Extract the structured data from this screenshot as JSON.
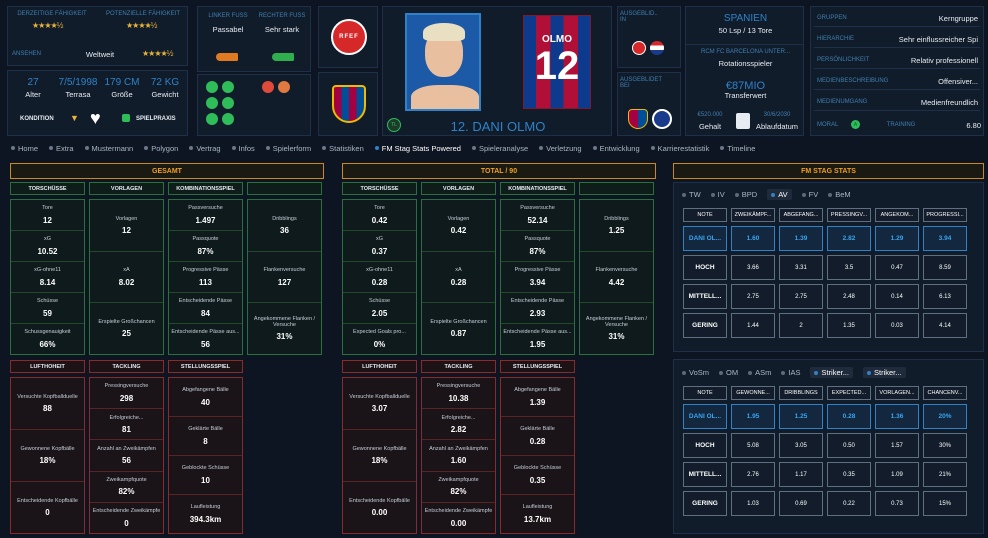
{
  "header": {
    "ratings": {
      "current_label": "Derzeitige Fähigkeit",
      "current_stars": "★★★★½",
      "potential_label": "Potenzielle Fähigkeit",
      "potential_stars": "★★★★½",
      "reputation_label": "Ansehen",
      "reputation_value": "Weltweit",
      "reputation_stars": "★★★★½"
    },
    "bio": {
      "age": "27",
      "age_label": "Alter",
      "dob": "7/5/1998",
      "dob_label": "Terrasa",
      "height": "179 CM",
      "height_label": "Größe",
      "weight": "72 KG",
      "weight_label": "Gewicht",
      "condition_label": "Kondition",
      "practice_label": "Spielpraxis"
    },
    "feet": {
      "left_label": "Linker Fuß",
      "left_value": "Passabel",
      "right_label": "Rechter Fuß",
      "right_value": "Sehr stark"
    },
    "player": {
      "number": "12",
      "shirt_name": "OLMO",
      "title": "12. DANI OLMO",
      "badge": "TL"
    },
    "nation": {
      "label": "Ausgeblid.. in",
      "country": "SPANIEN",
      "caps": "50 Lsp / 13 Tore"
    },
    "club": {
      "label": "Ausgeblidet bei",
      "name": "RCM FC BARCELONA UNTER...",
      "role": "Rotationsspieler",
      "value": "€87MIO",
      "value_label": "Transferwert",
      "wage": "€520.000",
      "wage_label": "Gehalt",
      "expiry": "30/6/2030",
      "expiry_label": "Ablaufdatum"
    },
    "personality": [
      {
        "label": "Gruppen",
        "value": "Kerngruppe"
      },
      {
        "label": "Hierarchie",
        "value": "Sehr einflussreicher Spi"
      },
      {
        "label": "Persönlichkeit",
        "value": "Relativ professionell"
      },
      {
        "label": "Medienbeschreibung",
        "value": "Offensiver..."
      },
      {
        "label": "Medienumgang",
        "value": "Medienfreundlich"
      }
    ],
    "morale": {
      "label": "Moral",
      "training_label": "Training",
      "training_value": "6.80",
      "morale_badge": "A"
    }
  },
  "tabs": [
    "Home",
    "Extra",
    "Mustermann",
    "Polygon",
    "Vertrag",
    "Infos",
    "Spielerform",
    "Statistiken",
    "FM Stag Stats Powered",
    "Spieleranalyse",
    "Verletzung",
    "Entwicklung",
    "Karrierestatistik",
    "Timeline"
  ],
  "gesamt": {
    "title": "GESAMT",
    "heads": {
      "shots": "TORSCHÜSSE",
      "assists": "VORLAGEN",
      "combo": "KOMBINATIONSSPIEL",
      "air": "LUFTHOHEIT",
      "tackle": "TACKLING",
      "pos": "STELLUNGSSPIEL"
    },
    "shots": [
      [
        "Tore",
        "12"
      ],
      [
        "xG",
        "10.52"
      ],
      [
        "xG-ohne11",
        "8.14"
      ],
      [
        "Schüsse",
        "59"
      ],
      [
        "Schussgenauigkeit",
        "66%"
      ]
    ],
    "assists": [
      [
        "Vorlagen",
        "12"
      ],
      [
        "xA",
        "8.02"
      ],
      [
        "Erspielte Großchancen",
        "25"
      ]
    ],
    "combo": [
      [
        "Passversuche",
        "1.497"
      ],
      [
        "Passquote",
        "87%"
      ],
      [
        "Progressive Pässe",
        "113"
      ],
      [
        "Entscheidende Pässe",
        "84"
      ],
      [
        "Entscheidende Pässe aus...",
        "56"
      ]
    ],
    "combo2": [
      [
        "Dribblings",
        "36"
      ],
      [
        "Flankenversuche",
        "127"
      ],
      [
        "Angekommene Flanken / Versuche",
        "31%"
      ]
    ],
    "air": [
      [
        "Versuchte Kopfballduelle",
        "88"
      ],
      [
        "Gewonnene Kopfbälle",
        "18%"
      ],
      [
        "Entscheidende Kopfbälle",
        "0"
      ]
    ],
    "tackle": [
      [
        "Pressingversuche",
        "298"
      ],
      [
        "Erfolgreiche...",
        "81"
      ],
      [
        "Anzahl an Zweikämpfen",
        "56"
      ],
      [
        "Zweikampfquote",
        "82%"
      ],
      [
        "Entscheidende Zweikämpfe",
        "0"
      ]
    ],
    "pos": [
      [
        "Abgefangene Bälle",
        "40"
      ],
      [
        "Geklärte Bälle",
        "8"
      ],
      [
        "Geblockte Schüsse",
        "10"
      ],
      [
        "Laufleistung",
        "394.3km"
      ]
    ]
  },
  "per90": {
    "title": "TOTAL / 90",
    "shots": [
      [
        "Tore",
        "0.42"
      ],
      [
        "xG",
        "0.37"
      ],
      [
        "xG-ohne11",
        "0.28"
      ],
      [
        "Schüsse",
        "2.05"
      ],
      [
        "Expected Goals pro...",
        "0%"
      ]
    ],
    "assists": [
      [
        "Vorlagen",
        "0.42"
      ],
      [
        "xA",
        "0.28"
      ],
      [
        "Erspielte Großchancen",
        "0.87"
      ]
    ],
    "combo": [
      [
        "Passversuche",
        "52.14"
      ],
      [
        "Passquote",
        "87%"
      ],
      [
        "Progressive Pässe",
        "3.94"
      ],
      [
        "Entscheidende Pässe",
        "2.93"
      ],
      [
        "Entscheidende Pässe aus...",
        "1.95"
      ]
    ],
    "combo2": [
      [
        "Dribblings",
        "1.25"
      ],
      [
        "Flankenversuche",
        "4.42"
      ],
      [
        "Angekommene Flanken / Versuche",
        "31%"
      ]
    ],
    "air": [
      [
        "Versuchte Kopfballduelle",
        "3.07"
      ],
      [
        "Gewonnene Kopfbälle",
        "18%"
      ],
      [
        "Entscheidende Kopfbälle",
        "0.00"
      ]
    ],
    "tackle": [
      [
        "Pressingversuche",
        "10.38"
      ],
      [
        "Erfolgreiche...",
        "2.82"
      ],
      [
        "Anzahl an Zweikämpfen",
        "1.60"
      ],
      [
        "Zweikampfquote",
        "82%"
      ],
      [
        "Entscheidende Zweikämpfe",
        "0.00"
      ]
    ],
    "pos": [
      [
        "Abgefangene Bälle",
        "1.39"
      ],
      [
        "Geklärte Bälle",
        "0.28"
      ],
      [
        "Geblockte Schüsse",
        "0.35"
      ],
      [
        "Laufleistung",
        "13.7km"
      ]
    ]
  },
  "stag": {
    "title": "FM STAG STATS",
    "tabs1": [
      "TW",
      "IV",
      "BPD",
      "AV",
      "FV",
      "BeM"
    ],
    "tabs1_active": "AV",
    "t1_head": [
      "NOTE",
      "ZWEIKÄMPF...",
      "ABGEFANG...",
      "PRESSINGV...",
      "ANGEKOM...",
      "PROGRESSI..."
    ],
    "t1_rows": [
      [
        "DANI OL...",
        "1.60",
        "1.39",
        "2.82",
        "1.29",
        "3.94"
      ],
      [
        "HOCH",
        "3.66",
        "3.31",
        "3.5",
        "0.47",
        "8.59"
      ],
      [
        "MITTELL...",
        "2.75",
        "2.75",
        "2.48",
        "0.14",
        "6.13"
      ],
      [
        "GERING",
        "1.44",
        "2",
        "1.35",
        "0.03",
        "4.14"
      ]
    ],
    "tabs2": [
      "VoSm",
      "OM",
      "ASm",
      "IAS",
      "Striker...",
      "Striker..."
    ],
    "tabs2_active": "Striker...",
    "t2_head": [
      "NOTE",
      "GEWONNE...",
      "DRIBBLINGS",
      "EXPECTED...",
      "VORLAGEN...",
      "CHANCENV..."
    ],
    "t2_rows": [
      [
        "DANI OL...",
        "1.95",
        "1.25",
        "0.28",
        "1.36",
        "20%"
      ],
      [
        "HOCH",
        "5.08",
        "3.05",
        "0.50",
        "1.57",
        "30%"
      ],
      [
        "MITTELL...",
        "2.76",
        "1.17",
        "0.35",
        "1.09",
        "21%"
      ],
      [
        "GERING",
        "1.03",
        "0.69",
        "0.22",
        "0.73",
        "15%"
      ]
    ]
  },
  "logos": {
    "federation": "RFEF",
    "club_short": "FCB"
  }
}
